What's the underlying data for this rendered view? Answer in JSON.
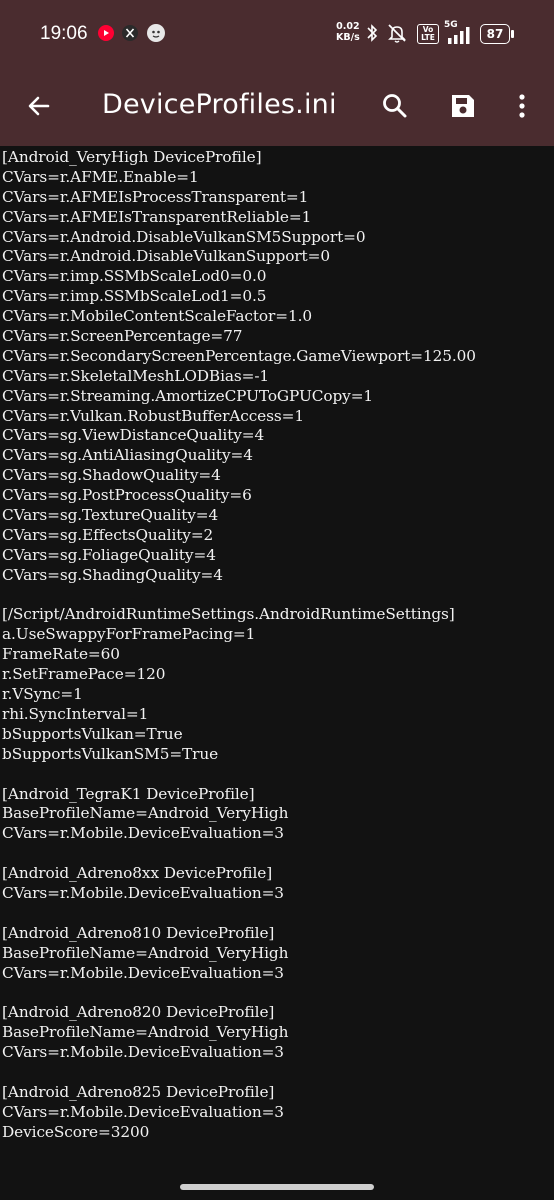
{
  "status_bar": {
    "time": "19:06",
    "net_speed_value": "0.02",
    "net_speed_unit": "KB/s",
    "volte_top": "Vo",
    "volte_bottom": "LTE",
    "network_type": "5G",
    "battery": "87"
  },
  "app_bar": {
    "title": "DeviceProfiles.ini"
  },
  "editor": {
    "lines": [
      "[Android_VeryHigh DeviceProfile]",
      "CVars=r.AFME.Enable=1",
      "CVars=r.AFMEIsProcessTransparent=1",
      "CVars=r.AFMEIsTransparentReliable=1",
      "CVars=r.Android.DisableVulkanSM5Support=0",
      "CVars=r.Android.DisableVulkanSupport=0",
      "CVars=r.imp.SSMbScaleLod0=0.0",
      "CVars=r.imp.SSMbScaleLod1=0.5",
      "CVars=r.MobileContentScaleFactor=1.0",
      "CVars=r.ScreenPercentage=77",
      "CVars=r.SecondaryScreenPercentage.GameViewport=125.00",
      "CVars=r.SkeletalMeshLODBias=-1",
      "CVars=r.Streaming.AmortizeCPUToGPUCopy=1",
      "CVars=r.Vulkan.RobustBufferAccess=1",
      "CVars=sg.ViewDistanceQuality=4",
      "CVars=sg.AntiAliasingQuality=4",
      "CVars=sg.ShadowQuality=4",
      "CVars=sg.PostProcessQuality=6",
      "CVars=sg.TextureQuality=4",
      "CVars=sg.EffectsQuality=2",
      "CVars=sg.FoliageQuality=4",
      "CVars=sg.ShadingQuality=4",
      "",
      "[/Script/AndroidRuntimeSettings.AndroidRuntimeSettings]",
      "a.UseSwappyForFramePacing=1",
      "FrameRate=60",
      "r.SetFramePace=120",
      "r.VSync=1",
      "rhi.SyncInterval=1",
      "bSupportsVulkan=True",
      "bSupportsVulkanSM5=True",
      "",
      "[Android_TegraK1 DeviceProfile]",
      "BaseProfileName=Android_VeryHigh",
      "CVars=r.Mobile.DeviceEvaluation=3",
      "",
      "[Android_Adreno8xx DeviceProfile]",
      "CVars=r.Mobile.DeviceEvaluation=3",
      "",
      "[Android_Adreno810 DeviceProfile]",
      "BaseProfileName=Android_VeryHigh",
      "CVars=r.Mobile.DeviceEvaluation=3",
      "",
      "[Android_Adreno820 DeviceProfile]",
      "BaseProfileName=Android_VeryHigh",
      "CVars=r.Mobile.DeviceEvaluation=3",
      "",
      "[Android_Adreno825 DeviceProfile]",
      "CVars=r.Mobile.DeviceEvaluation=3",
      "DeviceScore=3200"
    ]
  },
  "icons": {
    "back": "arrow-back-icon",
    "search": "search-icon",
    "save": "save-icon",
    "more": "more-vert-icon"
  },
  "colors": {
    "app_bar": "#4a2c2f",
    "background": "#121212",
    "text": "#f2f2f2",
    "youtube_red": "#ff0033"
  }
}
